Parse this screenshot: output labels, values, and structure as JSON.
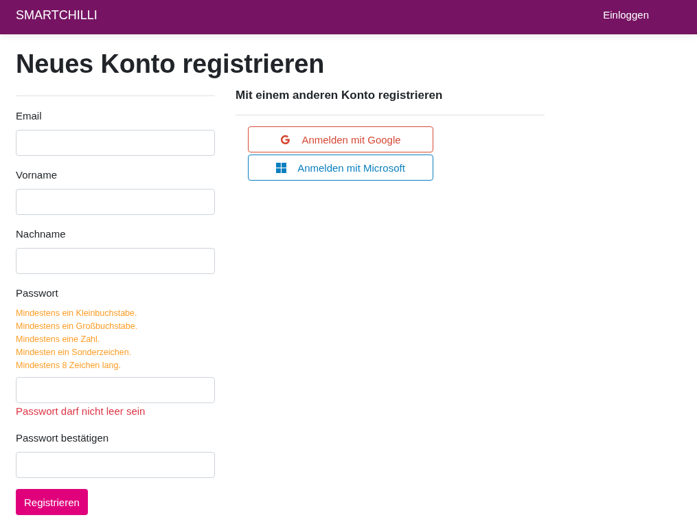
{
  "navbar": {
    "brand": "SMARTCHILLI",
    "links": [
      {
        "label": "Einloggen"
      }
    ]
  },
  "title": "Neues Konto registrieren",
  "form": {
    "fields": [
      {
        "label": "Email"
      },
      {
        "label": "Vorname"
      },
      {
        "label": "Nachname"
      },
      {
        "label": "Passwort",
        "hints": [
          "Mindestens ein Kleinbuchstabe.",
          "Mindestens ein Großbuchstabe.",
          "Mindestens eine Zahl.",
          "Mindesten ein Sonderzeichen.",
          "Mindestens 8 Zeichen lang."
        ],
        "error": "Passwort darf nicht leer sein"
      },
      {
        "label": "Passwort bestätigen"
      }
    ],
    "submit": "Registrieren"
  },
  "external": {
    "heading": "Mit einem anderen Konto registrieren",
    "providers": [
      {
        "label": "Anmelden mit Google",
        "kind": "google"
      },
      {
        "label": "Anmelden mit Microsoft",
        "kind": "microsoft"
      }
    ]
  }
}
